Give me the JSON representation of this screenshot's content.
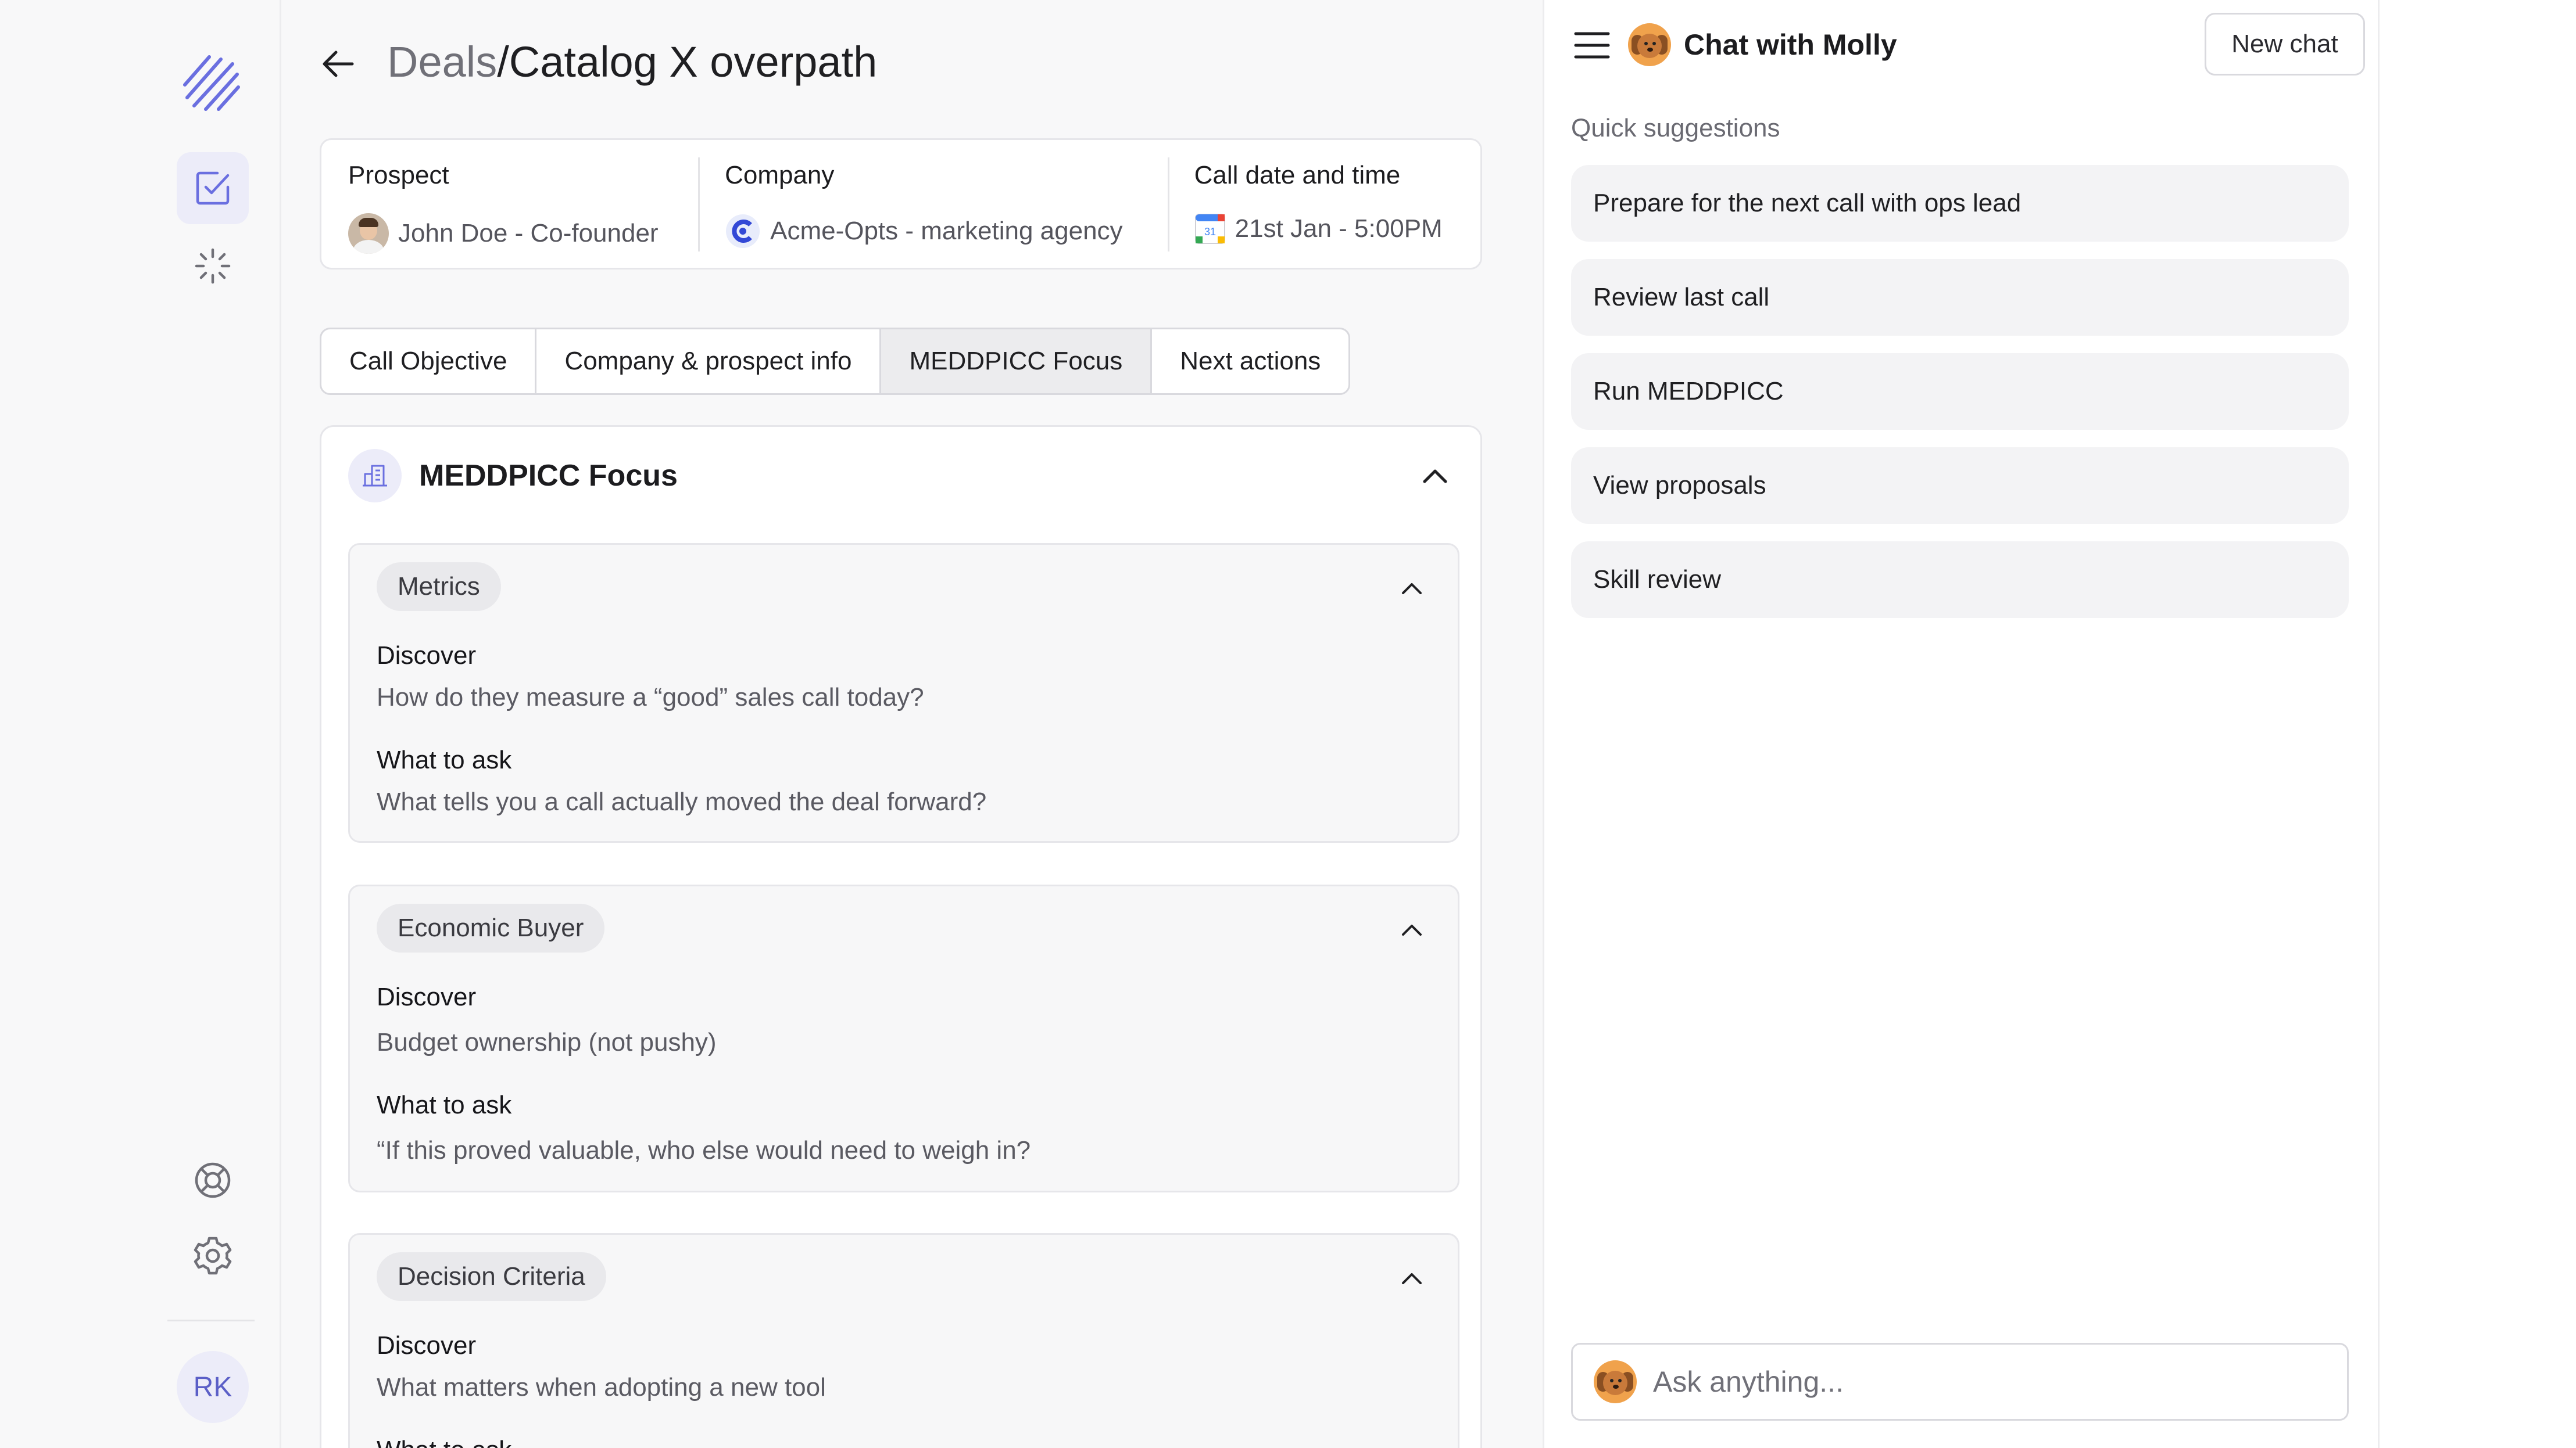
{
  "sidebar": {
    "user_initials": "RK",
    "icons": [
      "logo-icon",
      "checklist-icon",
      "loader-icon",
      "help-icon",
      "gear-icon"
    ]
  },
  "header": {
    "breadcrumb": "Deals",
    "separator": "/",
    "title": "Catalog X overpath"
  },
  "info": {
    "prospect_label": "Prospect",
    "prospect_value": "John Doe - Co-founder",
    "company_label": "Company",
    "company_value": "Acme-Opts - marketing agency",
    "call_label": "Call date and time",
    "call_value": "21st Jan - 5:00PM"
  },
  "tabs": [
    {
      "label": "Call Objective",
      "active": false
    },
    {
      "label": "Company & prospect info",
      "active": false
    },
    {
      "label": "MEDDPICC Focus",
      "active": true
    },
    {
      "label": "Next actions",
      "active": false
    }
  ],
  "focus": {
    "title": "MEDDPICC Focus",
    "sections": [
      {
        "name": "Metrics",
        "discover_label": "Discover",
        "discover_text": "How do they measure a “good” sales call today?",
        "ask_label": "What to ask",
        "ask_text": "What tells you a call actually moved the deal forward?"
      },
      {
        "name": "Economic Buyer",
        "discover_label": "Discover",
        "discover_text": "Budget ownership (not pushy)",
        "ask_label": "What to ask",
        "ask_text": "“If this proved valuable, who else would need to weigh in?"
      },
      {
        "name": "Decision Criteria",
        "discover_label": "Discover",
        "discover_text": "What matters when adopting a new tool",
        "ask_label": "What to ask",
        "ask_text": ""
      }
    ]
  },
  "chat": {
    "title": "Chat with Molly",
    "new_chat_label": "New chat",
    "quick_suggestions_label": "Quick suggestions",
    "suggestions": [
      "Prepare for the next call with ops lead",
      "Review last call",
      "Run MEDDPICC",
      "View proposals",
      "Skill review"
    ],
    "input_placeholder": "Ask anything..."
  },
  "colors": {
    "accent": "#5b5fc7",
    "accent_bg": "#ececf9",
    "page_bg": "#f8f8f9",
    "card_border": "#e6e6ea"
  }
}
